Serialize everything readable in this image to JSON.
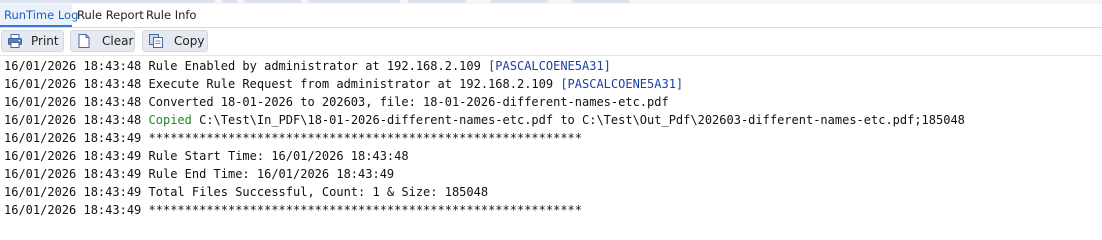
{
  "tabs": [
    {
      "label": "RunTime Log",
      "active": true
    },
    {
      "label": "Rule Report",
      "active": false
    },
    {
      "label": "Rule Info",
      "active": false
    }
  ],
  "toolbar": {
    "print_label": "Print",
    "clear_label": "Clear",
    "copy_label": "Copy",
    "print_icon": "printer-icon",
    "clear_icon": "document-icon",
    "copy_icon": "copy-icon"
  },
  "colors": {
    "accent": "#3a78d6",
    "active_tab_bg": "#eaf1fb",
    "host_text": "#1b3fa6",
    "success_text": "#1e8a1e"
  },
  "log": [
    {
      "timestamp": "16/01/2026 18:43:48",
      "message": "Rule Enabled by administrator at 192.168.2.109 ",
      "host": "[PASCALCOENE5A31]"
    },
    {
      "timestamp": "16/01/2026 18:43:48",
      "message": "Execute Rule Request from administrator at 192.168.2.109 ",
      "host": "[PASCALCOENE5A31]"
    },
    {
      "timestamp": "16/01/2026 18:43:48",
      "message": "Converted 18-01-2026 to 202603, file: 18-01-2026-different-names-etc.pdf"
    },
    {
      "timestamp": "16/01/2026 18:43:48",
      "prefix": "Copied",
      "message": " C:\\Test\\In_PDF\\18-01-2026-different-names-etc.pdf to C:\\Test\\Out_Pdf\\202603-different-names-etc.pdf;185048"
    },
    {
      "timestamp": "16/01/2026 18:43:49",
      "message": "************************************************************"
    },
    {
      "timestamp": "16/01/2026 18:43:49",
      "message": "Rule Start Time: 16/01/2026 18:43:48"
    },
    {
      "timestamp": "16/01/2026 18:43:49",
      "message": "Rule End Time: 16/01/2026 18:43:49"
    },
    {
      "timestamp": "16/01/2026 18:43:49",
      "message": "Total Files Successful, Count: 1 & Size: 185048"
    },
    {
      "timestamp": "16/01/2026 18:43:49",
      "message": "************************************************************"
    }
  ]
}
